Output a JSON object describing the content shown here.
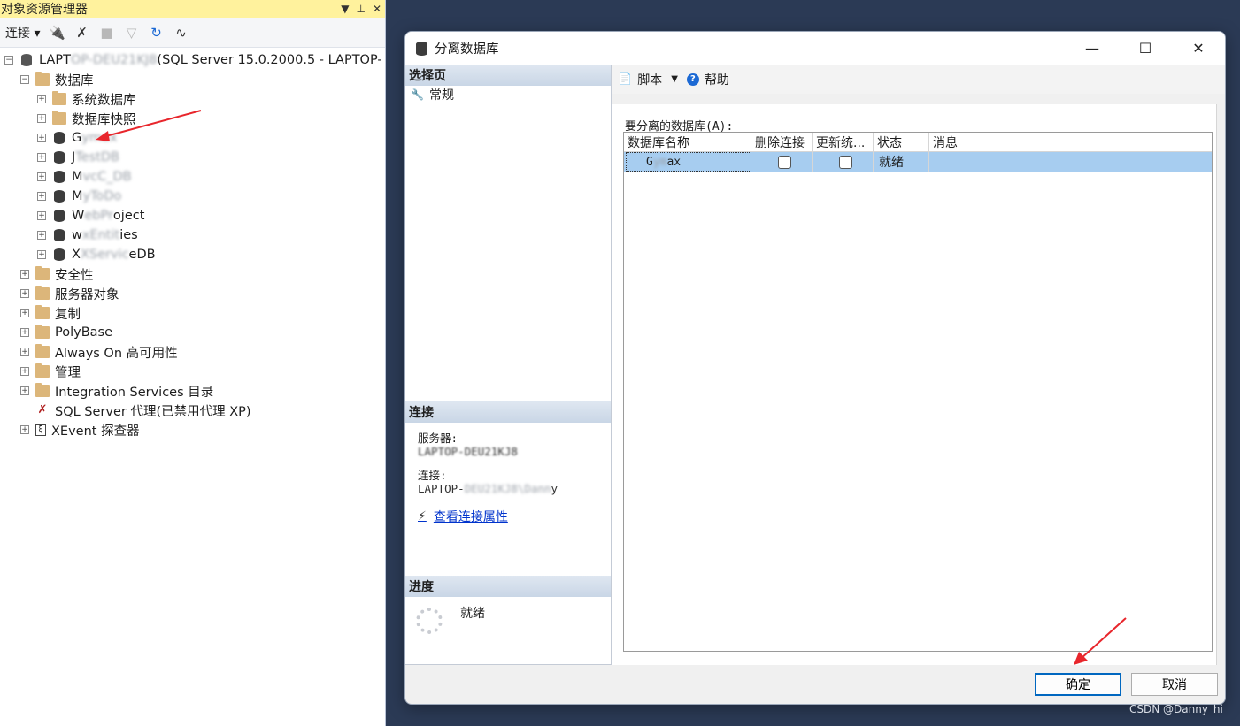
{
  "object_explorer": {
    "title": "对象资源管理器",
    "toolbar": {
      "connect_label": "连接"
    },
    "tree": {
      "server": {
        "prefix": "LAPT",
        "masked": "OP-DEU21KJ8",
        "suffix": " (SQL Server 15.0.2000.5 - LAPTOP-"
      },
      "databases": "数据库",
      "system_databases": "系统数据库",
      "database_snapshots": "数据库快照",
      "db_items": [
        {
          "visible": "G",
          "masked": "ymax",
          "tail": ""
        },
        {
          "visible": "J",
          "masked": "TestDB",
          "tail": ""
        },
        {
          "visible": "M",
          "masked": "vcC_DB",
          "tail": ""
        },
        {
          "visible": "M",
          "masked": "yToDo",
          "tail": ""
        },
        {
          "visible": "W",
          "masked": "ebPr",
          "tail": "oject"
        },
        {
          "visible": "w",
          "masked": "xEntit",
          "tail": "ies"
        },
        {
          "visible": "X",
          "masked": "XServic",
          "tail": "eDB"
        }
      ],
      "security": "安全性",
      "server_objects": "服务器对象",
      "replication": "复制",
      "polybase": "PolyBase",
      "always_on": "Always On 高可用性",
      "management": "管理",
      "integration_services": "Integration Services 目录",
      "sql_agent": "SQL Server 代理(已禁用代理 XP)",
      "xevent": "XEvent 探查器"
    }
  },
  "dialog": {
    "title": "分离数据库",
    "select_page_header": "选择页",
    "pages": [
      "常规"
    ],
    "toolbar": {
      "script_label": "脚本",
      "help_label": "帮助"
    },
    "grid_label": "要分离的数据库(A):",
    "columns": [
      "数据库名称",
      "删除连接",
      "更新统...",
      "状态",
      "消息"
    ],
    "rows": [
      {
        "name_visible": "G",
        "name_masked": "ym",
        "name_tail": "ax",
        "status": "就绪",
        "message": ""
      }
    ],
    "connection": {
      "header": "连接",
      "server_label": "服务器:",
      "server_value": "LAPTOP-DEU21KJ8",
      "conn_label": "连接:",
      "conn_value_prefix": "LAPTOP-",
      "conn_value_masked": "DEU21KJ8\\Dann",
      "conn_value_suffix": "y",
      "view_link": "查看连接属性"
    },
    "progress": {
      "header": "进度",
      "status": "就绪"
    },
    "buttons": {
      "ok": "确定",
      "cancel": "取消"
    }
  },
  "watermark": "CSDN @Danny_hi",
  "colors": {
    "oe_title_bg": "#fff29d",
    "desktop_bg": "#2b3a55",
    "selection": "#a7cdf0",
    "arrow": "#e8262c",
    "link": "#0033cc"
  }
}
